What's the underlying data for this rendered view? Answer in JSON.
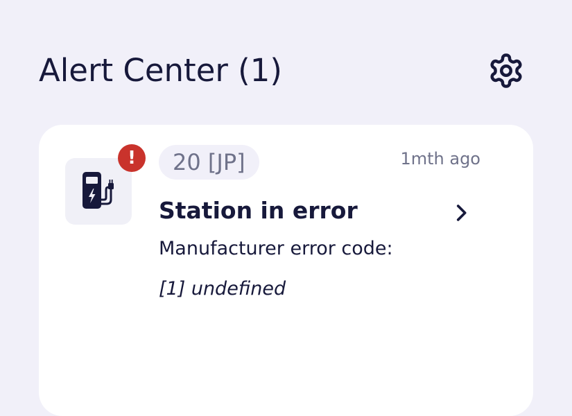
{
  "header": {
    "title": "Alert Center (1)",
    "settings_icon": "gear-icon"
  },
  "alerts": [
    {
      "station": "20 [JP]",
      "time_ago": "1mth ago",
      "title": "Station in error",
      "message_line1": "Manufacturer error code:",
      "message_line2": "[1] undefined",
      "icon": "ev-charger-icon",
      "badge_icon": "exclamation-icon",
      "badge_text": "!"
    }
  ],
  "colors": {
    "background": "#f1f0f9",
    "card": "#ffffff",
    "text": "#17193b",
    "muted": "#6f728a",
    "error": "#c9332c"
  }
}
